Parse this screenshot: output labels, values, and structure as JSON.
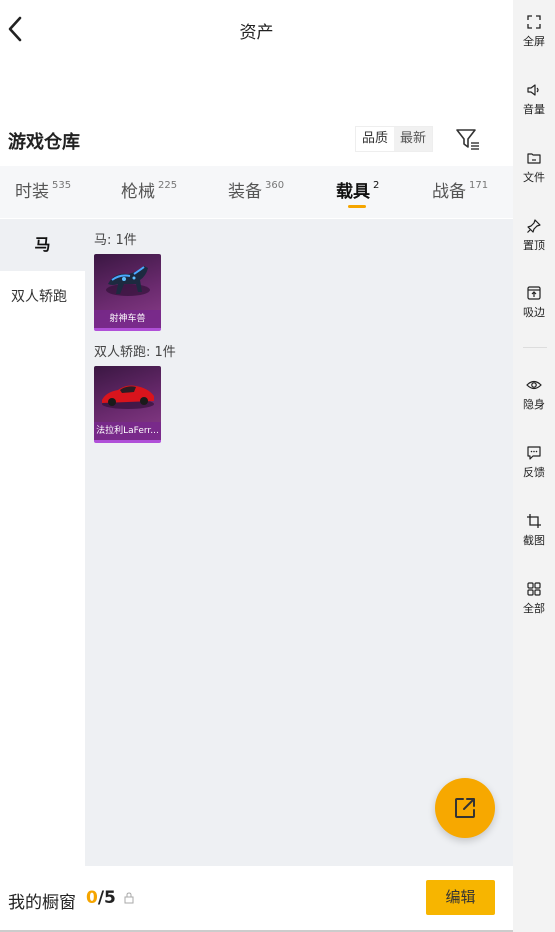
{
  "header": {
    "title": "资产",
    "back_icon": "chevron-left-icon"
  },
  "warehouse": {
    "title": "游戏仓库",
    "sort_options": [
      "品质",
      "最新"
    ],
    "filter_icon": "filter-icon"
  },
  "tabs": [
    {
      "label": "时装",
      "count": "535"
    },
    {
      "label": "枪械",
      "count": "225"
    },
    {
      "label": "装备",
      "count": "360"
    },
    {
      "label": "载具",
      "count": "2"
    },
    {
      "label": "战备",
      "count": "171"
    }
  ],
  "active_tab": "载具",
  "categories": [
    {
      "label": "马"
    },
    {
      "label": "双人轿跑"
    }
  ],
  "sections": [
    {
      "header": "马: 1件",
      "items": [
        {
          "name": "射神车兽"
        }
      ]
    },
    {
      "header": "双人轿跑: 1件",
      "items": [
        {
          "name": "法拉利LaFerr..."
        }
      ]
    }
  ],
  "fab": {
    "icon": "external-link-icon"
  },
  "showcase": {
    "label": "我的橱窗",
    "current": "0",
    "total": "/5",
    "edit_label": "编辑"
  },
  "toolbar": [
    {
      "label": "全屏",
      "icon": "fullscreen-icon"
    },
    {
      "label": "音量",
      "icon": "volume-icon"
    },
    {
      "label": "文件",
      "icon": "folder-icon"
    },
    {
      "label": "置顶",
      "icon": "pin-icon"
    },
    {
      "label": "吸边",
      "icon": "dock-icon"
    },
    {
      "label": "隐身",
      "icon": "eye-icon"
    },
    {
      "label": "反馈",
      "icon": "feedback-icon"
    },
    {
      "label": "截图",
      "icon": "crop-icon"
    },
    {
      "label": "全部",
      "icon": "grid-icon"
    }
  ],
  "colors": {
    "accent": "#f5a500",
    "card_bg": "#6a2a6e",
    "panel_bg": "#eef0f3"
  }
}
